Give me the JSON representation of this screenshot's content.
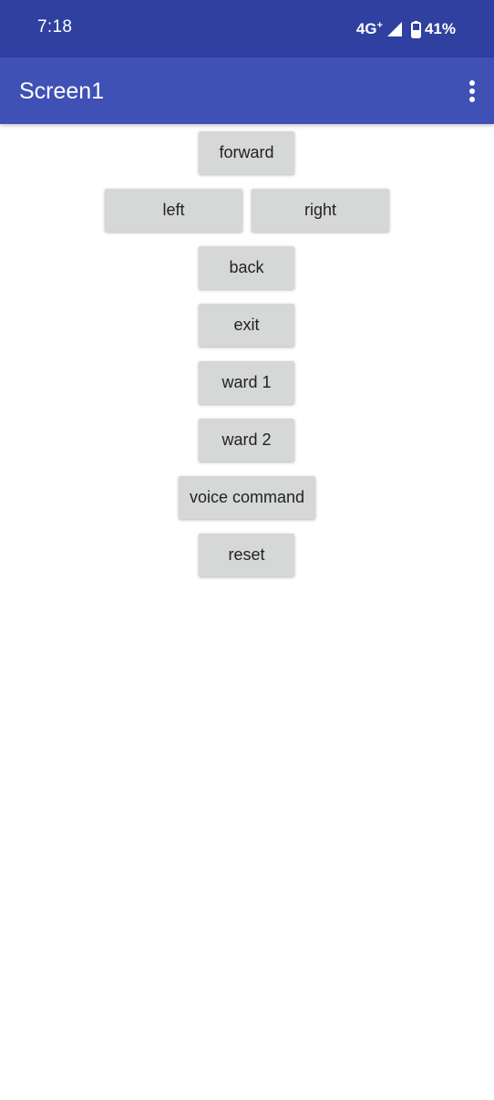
{
  "status_bar": {
    "time": "7:18",
    "network": "4G",
    "network_suffix": "+",
    "battery_percent": "41%",
    "signal_icon": "cell-signal-icon",
    "battery_icon": "battery-icon"
  },
  "app_bar": {
    "title": "Screen1",
    "menu_icon": "overflow-menu-icon"
  },
  "buttons": {
    "forward": "forward",
    "left": "left",
    "right": "right",
    "back": "back",
    "exit": "exit",
    "ward1": "ward 1",
    "ward2": "ward 2",
    "voice_command": "voice command",
    "reset": "reset"
  },
  "colors": {
    "status_bar": "#3040a0",
    "app_bar": "#3f51b5",
    "button_bg": "#d6d7d7",
    "button_text": "#222222"
  }
}
